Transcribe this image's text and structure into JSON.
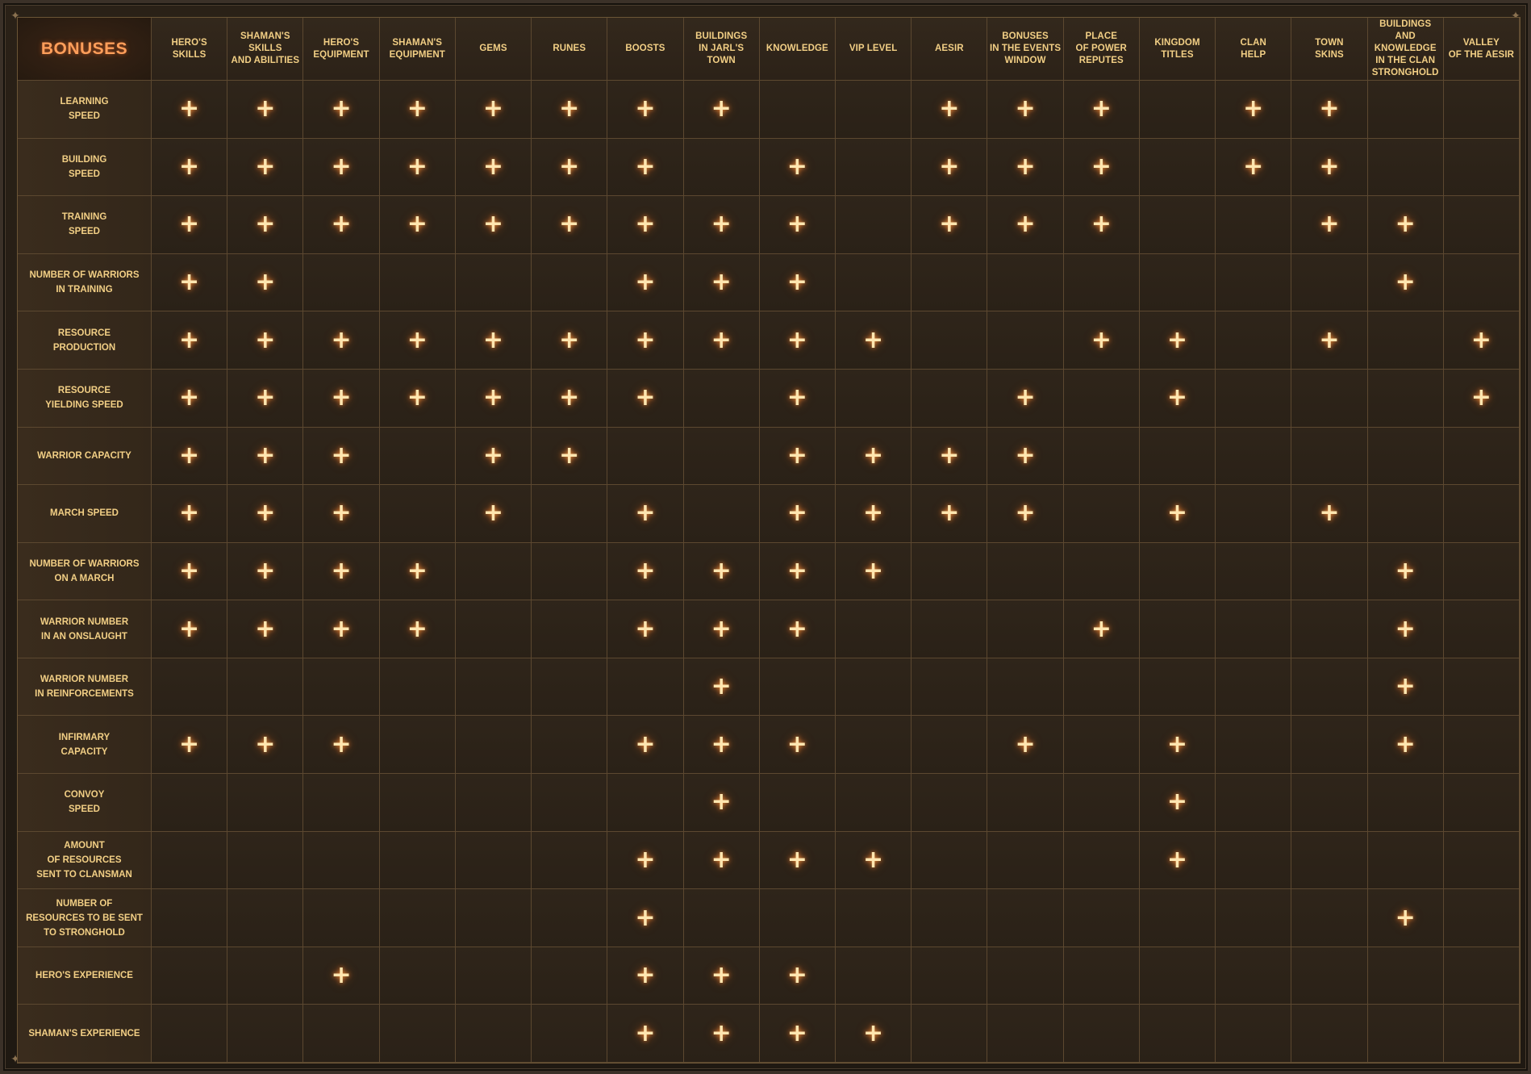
{
  "title": "BONUSES",
  "columns": [
    "HERO'S\nSKILLS",
    "SHAMAN'S\nSKILLS\nAND ABILITIES",
    "HERO'S\nEQUIPMENT",
    "SHAMAN'S\nEQUIPMENT",
    "GEMS",
    "RUNES",
    "BOOSTS",
    "BUILDINGS\nIN JARL'S\nTOWN",
    "KNOWLEDGE",
    "VIP LEVEL",
    "AESIR",
    "BONUSES\nIN THE EVENTS\nWINDOW",
    "PLACE\nOF POWER\nREPUTES",
    "KINGDOM\nTITLES",
    "CLAN\nHELP",
    "TOWN\nSKINS",
    "BUILDINGS AND\nKNOWLEDGE\nIN THE CLAN\nSTRONGHOLD",
    "VALLEY\nOF THE AESIR"
  ],
  "mark_symbol": "+",
  "rows": [
    {
      "label": "LEARNING\nSPEED",
      "marks": [
        1,
        1,
        1,
        1,
        1,
        1,
        1,
        1,
        0,
        0,
        1,
        1,
        1,
        0,
        1,
        1,
        0,
        0
      ]
    },
    {
      "label": "BUILDING\nSPEED",
      "marks": [
        1,
        1,
        1,
        1,
        1,
        1,
        1,
        0,
        1,
        0,
        1,
        1,
        1,
        0,
        1,
        1,
        0,
        0
      ]
    },
    {
      "label": "TRAINING\nSPEED",
      "marks": [
        1,
        1,
        1,
        1,
        1,
        1,
        1,
        1,
        1,
        0,
        1,
        1,
        1,
        0,
        0,
        1,
        1,
        0
      ]
    },
    {
      "label": "NUMBER OF WARRIORS\nIN TRAINING",
      "marks": [
        1,
        1,
        0,
        0,
        0,
        0,
        1,
        1,
        1,
        0,
        0,
        0,
        0,
        0,
        0,
        0,
        1,
        0
      ]
    },
    {
      "label": "RESOURCE\nPRODUCTION",
      "marks": [
        1,
        1,
        1,
        1,
        1,
        1,
        1,
        1,
        1,
        1,
        0,
        0,
        1,
        1,
        0,
        1,
        0,
        1
      ]
    },
    {
      "label": "RESOURCE\nYIELDING SPEED",
      "marks": [
        1,
        1,
        1,
        1,
        1,
        1,
        1,
        0,
        1,
        0,
        0,
        1,
        0,
        1,
        0,
        0,
        0,
        1
      ]
    },
    {
      "label": "WARRIOR CAPACITY",
      "marks": [
        1,
        1,
        1,
        0,
        1,
        1,
        0,
        0,
        1,
        1,
        1,
        1,
        0,
        0,
        0,
        0,
        0,
        0
      ]
    },
    {
      "label": "MARCH SPEED",
      "marks": [
        1,
        1,
        1,
        0,
        1,
        0,
        1,
        0,
        1,
        1,
        1,
        1,
        0,
        1,
        0,
        1,
        0,
        0
      ]
    },
    {
      "label": "NUMBER OF WARRIORS\nON A MARCH",
      "marks": [
        1,
        1,
        1,
        1,
        0,
        0,
        1,
        1,
        1,
        1,
        0,
        0,
        0,
        0,
        0,
        0,
        1,
        0
      ]
    },
    {
      "label": "WARRIOR NUMBER\nIN AN ONSLAUGHT",
      "marks": [
        1,
        1,
        1,
        1,
        0,
        0,
        1,
        1,
        1,
        0,
        0,
        0,
        1,
        0,
        0,
        0,
        1,
        0
      ]
    },
    {
      "label": "WARRIOR NUMBER\nIN REINFORCEMENTS",
      "marks": [
        0,
        0,
        0,
        0,
        0,
        0,
        0,
        1,
        0,
        0,
        0,
        0,
        0,
        0,
        0,
        0,
        1,
        0
      ]
    },
    {
      "label": "INFIRMARY\nCAPACITY",
      "marks": [
        1,
        1,
        1,
        0,
        0,
        0,
        1,
        1,
        1,
        0,
        0,
        1,
        0,
        1,
        0,
        0,
        1,
        0
      ]
    },
    {
      "label": "CONVOY\nSPEED",
      "marks": [
        0,
        0,
        0,
        0,
        0,
        0,
        0,
        1,
        0,
        0,
        0,
        0,
        0,
        1,
        0,
        0,
        0,
        0
      ]
    },
    {
      "label": "AMOUNT\nOF RESOURCES\nSENT TO CLANSMAN",
      "marks": [
        0,
        0,
        0,
        0,
        0,
        0,
        1,
        1,
        1,
        1,
        0,
        0,
        0,
        1,
        0,
        0,
        0,
        0
      ]
    },
    {
      "label": "NUMBER OF\nRESOURCES TO BE SENT\nTO STRONGHOLD",
      "marks": [
        0,
        0,
        0,
        0,
        0,
        0,
        1,
        0,
        0,
        0,
        0,
        0,
        0,
        0,
        0,
        0,
        1,
        0
      ]
    },
    {
      "label": "HERO'S EXPERIENCE",
      "marks": [
        0,
        0,
        1,
        0,
        0,
        0,
        1,
        1,
        1,
        0,
        0,
        0,
        0,
        0,
        0,
        0,
        0,
        0
      ]
    },
    {
      "label": "SHAMAN'S EXPERIENCE",
      "marks": [
        0,
        0,
        0,
        0,
        0,
        0,
        1,
        1,
        1,
        1,
        0,
        0,
        0,
        0,
        0,
        0,
        0,
        0
      ]
    }
  ]
}
